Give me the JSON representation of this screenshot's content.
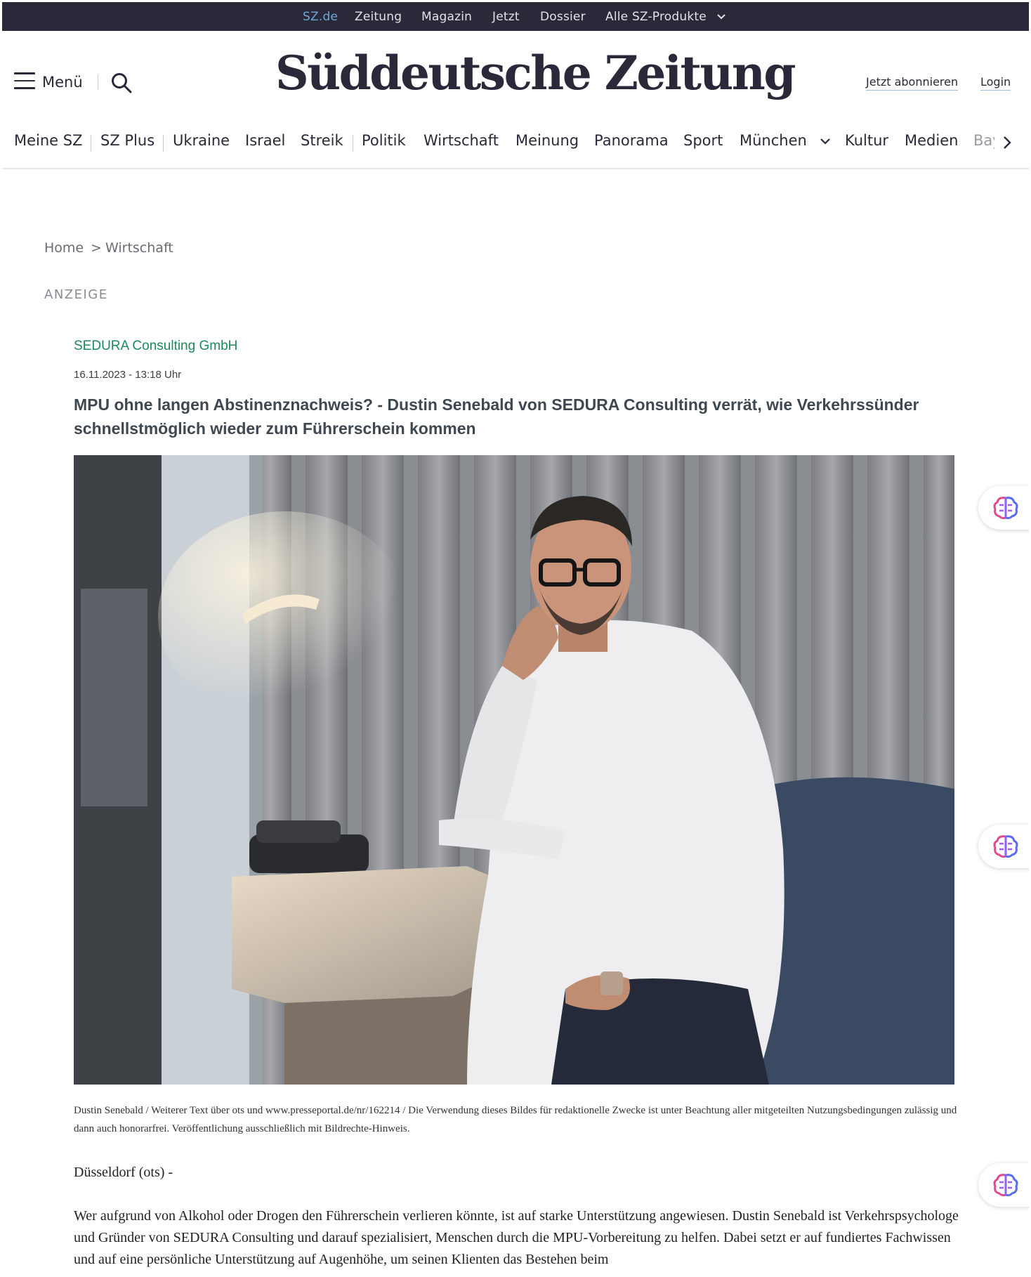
{
  "topbar": {
    "links": [
      "SZ.de",
      "Zeitung",
      "Magazin",
      "Jetzt",
      "Dossier",
      "Alle SZ-Produkte"
    ],
    "active": "SZ.de"
  },
  "header": {
    "menu_label": "Menü",
    "logo_text": "Süddeutsche Zeitung",
    "subscribe_label": "Jetzt abonnieren",
    "login_label": "Login"
  },
  "nav": {
    "items": [
      "Meine SZ",
      "SZ Plus",
      "Ukraine",
      "Israel",
      "Streik",
      "Politik",
      "Wirtschaft",
      "Meinung",
      "Panorama",
      "Sport",
      "München",
      "Kultur",
      "Medien",
      "Bay"
    ]
  },
  "breadcrumb": {
    "home": "Home",
    "separator": ">",
    "current": "Wirtschaft"
  },
  "article": {
    "ad_label": "ANZEIGE",
    "company": "SEDURA Consulting GmbH",
    "date": "16.11.2023 - 13:18 Uhr",
    "headline": "MPU ohne langen Abstinenznachweis? - Dustin Senebald von SEDURA Consulting verrät, wie Verkehrssünder schnellstmöglich wieder zum Führerschein kommen",
    "caption": "Dustin Senebald / Weiterer Text über ots und www.presseportal.de/nr/162214 / Die Verwendung dieses Bildes für redaktionelle Zwecke ist unter Beachtung aller mitgeteilten Nutzungsbedingungen zulässig und dann auch honorarfrei. Veröffentlichung ausschließlich mit Bildrechte-Hinweis.",
    "dateline": "Düsseldorf (ots) -",
    "paragraph": "Wer aufgrund von Alkohol oder Drogen den Führerschein verlieren könnte, ist auf starke Unterstützung angewiesen. Dustin Senebald ist Verkehrspsychologe und Gründer von SEDURA Consulting und darauf spezialisiert, Menschen durch die MPU-Vorbereitung zu helfen. Dabei setzt er auf fundiertes Fachwissen und auf eine persönliche Unterstützung auf Augenhöhe, um seinen Klienten das Bestehen beim"
  },
  "colors": {
    "topbar_bg": "#29293a",
    "active_link": "#6fa8d6",
    "company_green": "#1b8a5a",
    "headline_gray": "#3f4750"
  },
  "icons": {
    "menu": "hamburger-icon",
    "search": "search-icon",
    "dropdown": "chevron-down-icon",
    "scroll": "chevron-right-icon",
    "assistant": "brain-icon"
  }
}
